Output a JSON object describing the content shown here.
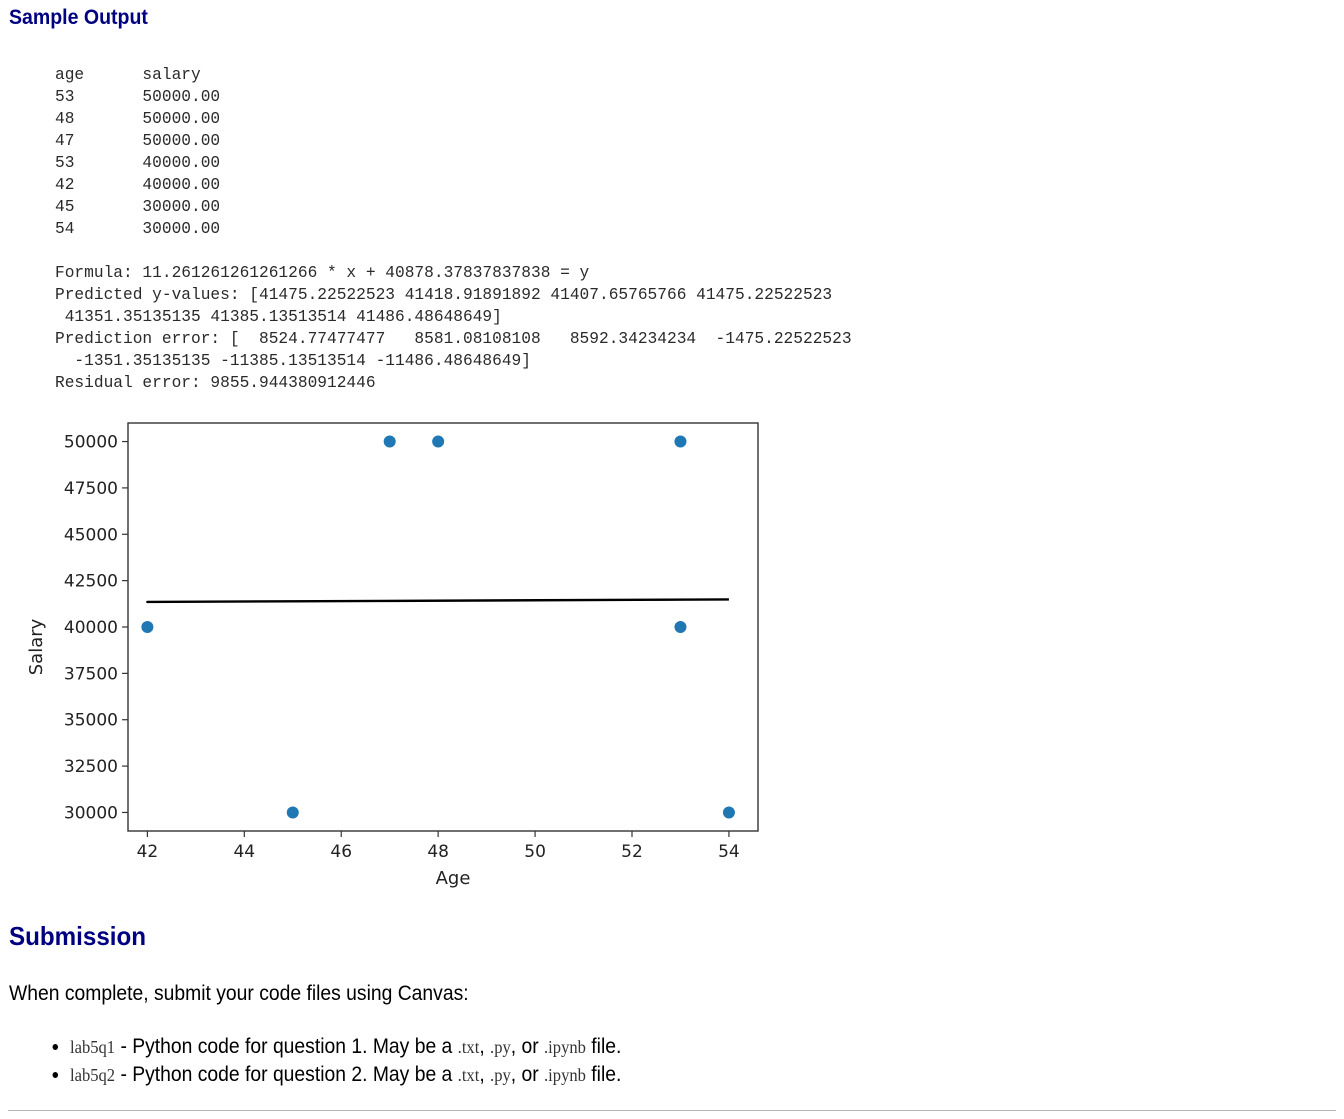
{
  "headings": {
    "sample_output": "Sample Output",
    "submission": "Submission"
  },
  "output_lines": [
    "age      salary",
    "53       50000.00",
    "48       50000.00",
    "47       50000.00",
    "53       40000.00",
    "42       40000.00",
    "45       30000.00",
    "54       30000.00",
    "",
    "Formula: 11.261261261261266 * x + 40878.37837837838 = y",
    "Predicted y-values: [41475.22522523 41418.91891892 41407.65765766 41475.22522523",
    " 41351.35135135 41385.13513514 41486.48648649]",
    "Prediction error: [  8524.77477477   8581.08108108   8592.34234234  -1475.22522523",
    "  -1351.35135135 -11385.13513514 -11486.48648649]",
    "Residual error: 9855.944380912446"
  ],
  "chart_data": {
    "type": "scatter",
    "xlabel": "Age",
    "ylabel": "Salary",
    "xlim": [
      41.6,
      54.6
    ],
    "ylim": [
      29000,
      51000
    ],
    "xticks": [
      42,
      44,
      46,
      48,
      50,
      52,
      54
    ],
    "yticks": [
      30000,
      32500,
      35000,
      37500,
      40000,
      42500,
      45000,
      47500,
      50000
    ],
    "grid": false,
    "point_color": "#1f77b4",
    "line_color": "#000000",
    "points": [
      {
        "x": 53,
        "y": 50000
      },
      {
        "x": 48,
        "y": 50000
      },
      {
        "x": 47,
        "y": 50000
      },
      {
        "x": 53,
        "y": 40000
      },
      {
        "x": 42,
        "y": 40000
      },
      {
        "x": 45,
        "y": 30000
      },
      {
        "x": 54,
        "y": 30000
      }
    ],
    "fit_line": [
      {
        "x": 53,
        "y": 41475.22522523
      },
      {
        "x": 48,
        "y": 41418.91891892
      },
      {
        "x": 47,
        "y": 41407.65765766
      },
      {
        "x": 53,
        "y": 41475.22522523
      },
      {
        "x": 42,
        "y": 41351.35135135
      },
      {
        "x": 45,
        "y": 41385.13513514
      },
      {
        "x": 54,
        "y": 41486.48648649
      }
    ]
  },
  "submission": {
    "intro": "When complete, submit your code files using Canvas:",
    "items": [
      {
        "name": "lab5q1",
        "text1": " - Python code for question 1. May be a ",
        "ext1": ".txt",
        "sep1": ", ",
        "ext2": ".py",
        "sep2": ", or ",
        "ext3": ".ipynb",
        "tail": " file."
      },
      {
        "name": "lab5q2",
        "text1": " - Python code for question 2. May be a ",
        "ext1": ".txt",
        "sep1": ", ",
        "ext2": ".py",
        "sep2": ", or ",
        "ext3": ".ipynb",
        "tail": " file."
      }
    ]
  }
}
